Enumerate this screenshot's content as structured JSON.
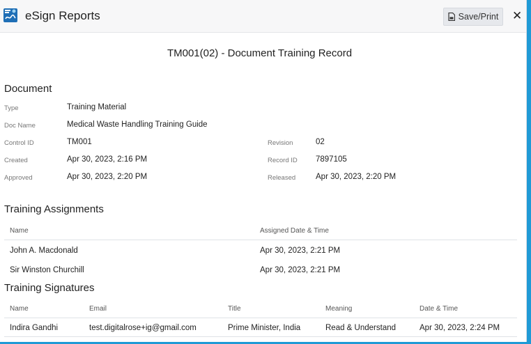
{
  "app": {
    "title": "eSign Reports"
  },
  "toolbar": {
    "save_label": "Save/Print",
    "close_label": "✕"
  },
  "record": {
    "heading": "TM001(02) - Document Training Record"
  },
  "document": {
    "section_title": "Document",
    "type_label": "Type",
    "type_value": "Training Material",
    "docname_label": "Doc Name",
    "docname_value": "Medical Waste Handling Training Guide",
    "controlid_label": "Control ID",
    "controlid_value": "TM001",
    "created_label": "Created",
    "created_value": "Apr 30, 2023, 2:16 PM",
    "approved_label": "Approved",
    "approved_value": "Apr 30, 2023, 2:20 PM",
    "revision_label": "Revision",
    "revision_value": "02",
    "recordid_label": "Record ID",
    "recordid_value": "7897105",
    "released_label": "Released",
    "released_value": "Apr 30, 2023, 2:20 PM"
  },
  "assignments": {
    "section_title": "Training Assignments",
    "columns": {
      "name": "Name",
      "assigned": "Assigned Date & Time"
    },
    "rows": [
      {
        "name": "John A. Macdonald",
        "assigned": "Apr 30, 2023, 2:21 PM"
      },
      {
        "name": "Sir Winston Churchill",
        "assigned": "Apr 30, 2023, 2:21 PM"
      }
    ]
  },
  "signatures": {
    "section_title": "Training Signatures",
    "columns": {
      "name": "Name",
      "email": "Email",
      "title": "Title",
      "meaning": "Meaning",
      "datetime": "Date & Time"
    },
    "rows": [
      {
        "name": "Indira Gandhi",
        "email": "test.digitalrose+ig@gmail.com",
        "title": "Prime Minister, India",
        "meaning": "Read & Understand",
        "datetime": "Apr 30, 2023, 2:24 PM"
      }
    ]
  },
  "colors": {
    "accent": "#1f9ad6",
    "header_bg": "#f7f7f8",
    "button_bg": "#e6e8ec"
  },
  "icons": {
    "app": "esign-report-icon",
    "save": "document-icon",
    "close": "close-icon"
  }
}
